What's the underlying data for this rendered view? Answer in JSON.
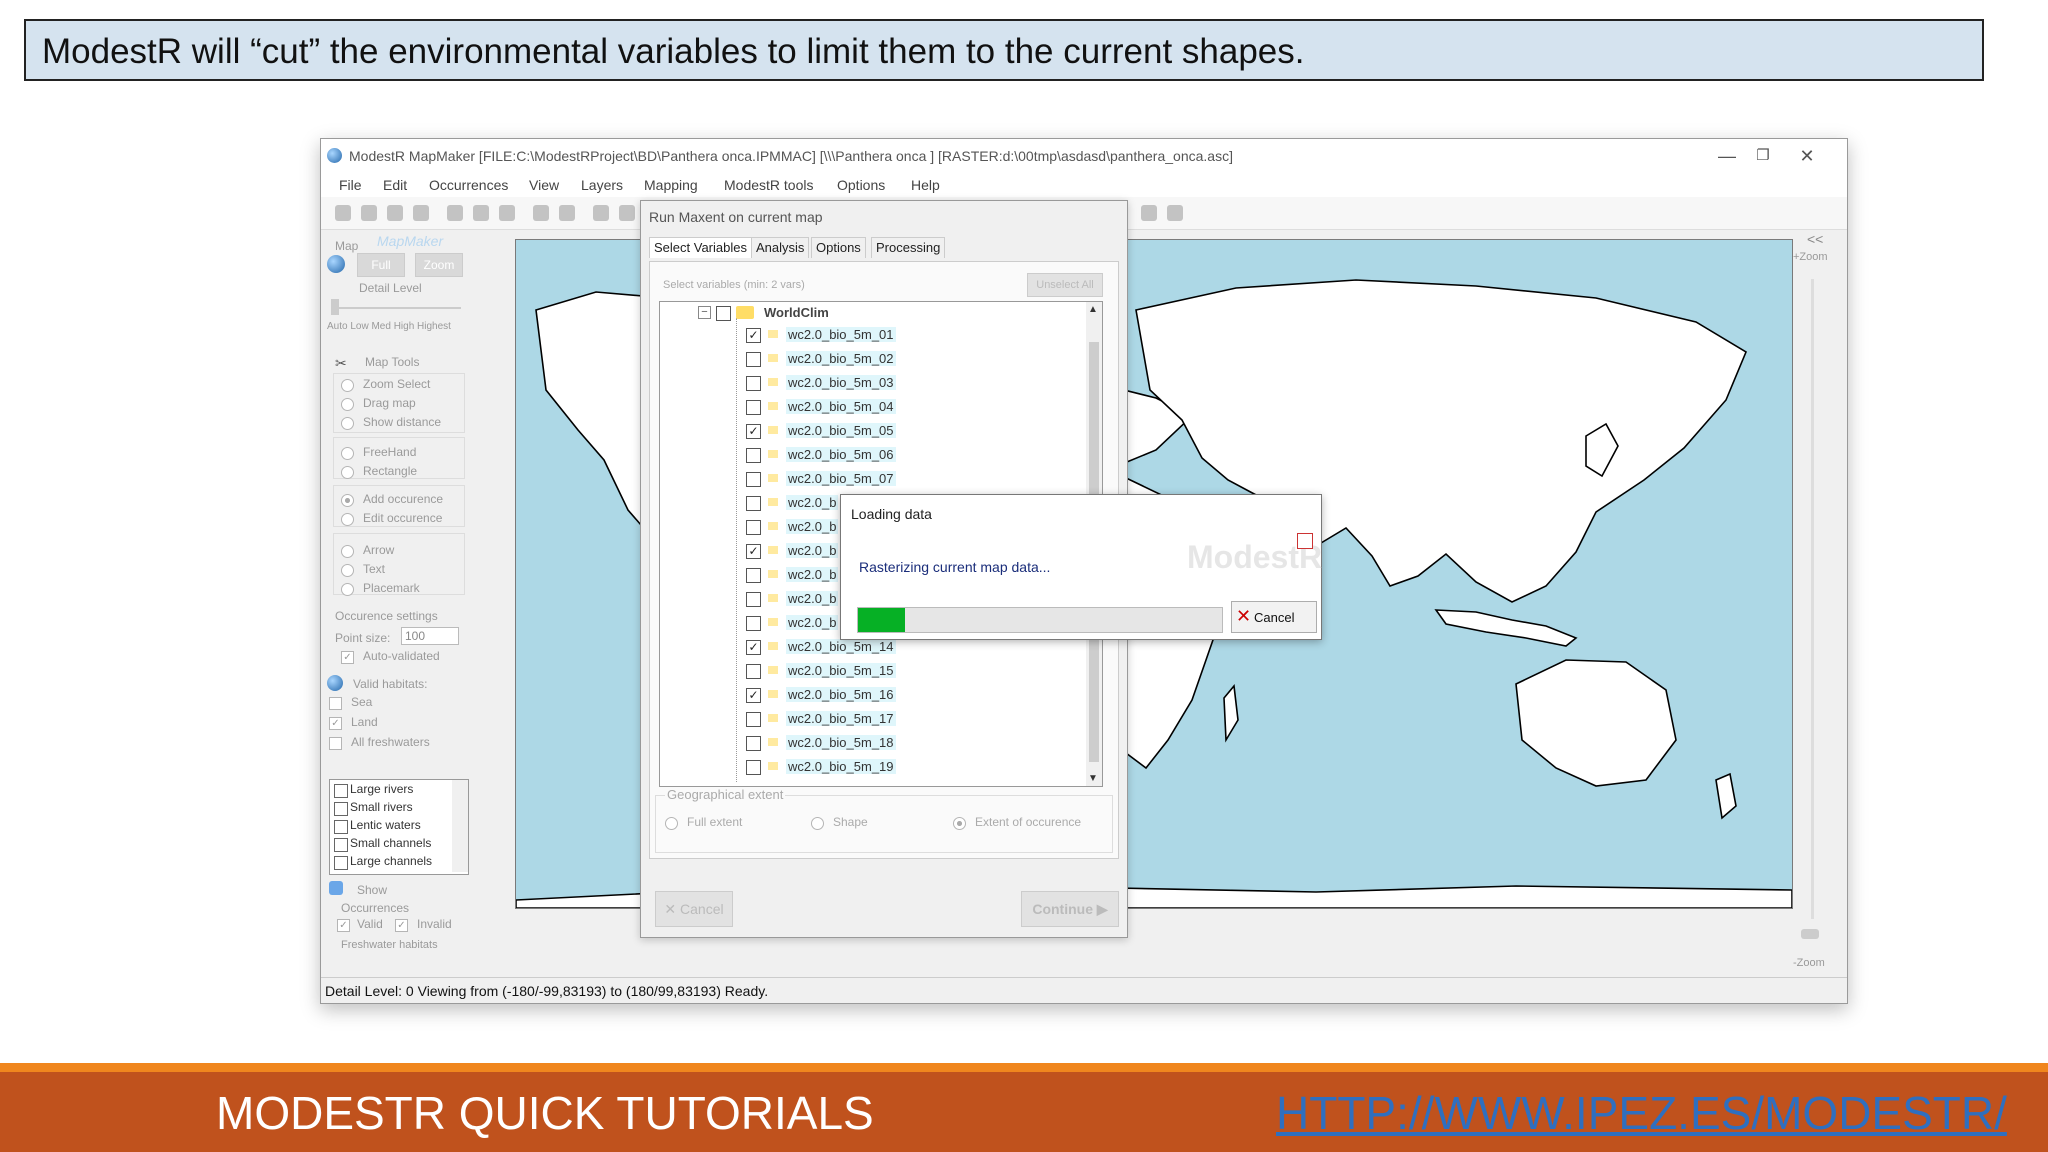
{
  "caption": "ModestR will “cut” the environmental variables to limit them to the current shapes.",
  "window": {
    "title": "ModestR MapMaker [FILE:C:\\ModestRProject\\BD\\Panthera onca.IPMMAC] [\\\\\\Panthera onca ] [RASTER:d:\\00tmp\\asdasd\\panthera_onca.asc]",
    "controls": {
      "minimize": "—",
      "restore": "❐",
      "close": "✕"
    },
    "menu": [
      "File",
      "Edit",
      "Occurrences",
      "View",
      "Layers",
      "Mapping",
      "ModestR tools",
      "Options",
      "Help"
    ]
  },
  "left_panel": {
    "map_label": "Map",
    "mapmaker_logo": "MapMaker",
    "full_btn": "Full",
    "zoom_btn": "Zoom",
    "detail_level": "Detail Level",
    "detail_scale": "Auto Low  Med  High  Highest",
    "map_tools": "Map Tools",
    "tools": [
      "Zoom Select",
      "Drag map",
      "Show distance",
      "FreeHand",
      "Rectangle",
      "Add occurence",
      "Edit occurence",
      "Arrow",
      "Text",
      "Placemark"
    ],
    "occ_settings": "Occurence settings",
    "point_size_label": "Point size:",
    "point_size": "100",
    "auto_validated": "Auto-validated",
    "valid_habitats": "Valid habitats:",
    "habitats": [
      "Sea",
      "Land",
      "All freshwaters"
    ],
    "freshwater_list": [
      "Large rivers",
      "Small rivers",
      "Lentic waters",
      "Small channels",
      "Large channels"
    ],
    "show": "Show",
    "occurrences": "Occurrences",
    "valid": "Valid",
    "invalid": "Invalid",
    "freshwater_habitats": "Freshwater habitats"
  },
  "zoom": {
    "plus": "+Zoom",
    "minus": "-Zoom",
    "collapse": "<<"
  },
  "status_bar": "Detail Level: 0   Viewing from (-180/-99,83193) to (180/99,83193)   Ready.",
  "maxent": {
    "title": "Run Maxent on current map",
    "tabs": [
      "Select Variables",
      "Analysis",
      "Options",
      "Processing"
    ],
    "select_hint": "Select variables (min: 2 vars)",
    "unselect_all": "Unselect All",
    "root": "WorldClim",
    "variables": [
      {
        "label": "wc2.0_bio_5m_01",
        "checked": true
      },
      {
        "label": "wc2.0_bio_5m_02",
        "checked": false
      },
      {
        "label": "wc2.0_bio_5m_03",
        "checked": false
      },
      {
        "label": "wc2.0_bio_5m_04",
        "checked": false
      },
      {
        "label": "wc2.0_bio_5m_05",
        "checked": true
      },
      {
        "label": "wc2.0_bio_5m_06",
        "checked": false
      },
      {
        "label": "wc2.0_bio_5m_07",
        "checked": false
      },
      {
        "label": "wc2.0_b",
        "checked": false
      },
      {
        "label": "wc2.0_b",
        "checked": false
      },
      {
        "label": "wc2.0_b",
        "checked": true
      },
      {
        "label": "wc2.0_b",
        "checked": false
      },
      {
        "label": "wc2.0_b",
        "checked": false
      },
      {
        "label": "wc2.0_b",
        "checked": false
      },
      {
        "label": "wc2.0_bio_5m_14",
        "checked": true
      },
      {
        "label": "wc2.0_bio_5m_15",
        "checked": false
      },
      {
        "label": "wc2.0_bio_5m_16",
        "checked": true
      },
      {
        "label": "wc2.0_bio_5m_17",
        "checked": false
      },
      {
        "label": "wc2.0_bio_5m_18",
        "checked": false
      },
      {
        "label": "wc2.0_bio_5m_19",
        "checked": false
      }
    ],
    "geo_extent": "Geographical extent",
    "extent_options": [
      "Full extent",
      "Shape",
      "Extent of occurence"
    ],
    "cancel": "Cancel",
    "continue": "Continue"
  },
  "loading": {
    "title": "Loading data",
    "message": "Rasterizing current map data...",
    "watermark": "ModestR",
    "progress": 0.13,
    "cancel": "Cancel"
  },
  "footer": {
    "left": "MODESTR QUICK TUTORIALS",
    "right": "HTTP://WWW.IPEZ.ES/MODESTR/"
  },
  "colors": {
    "ocean": "#add8e6",
    "land": "#ffffff",
    "progress": "#06b025",
    "footer": "#c0521d",
    "footer_accent": "#f0861e",
    "link": "#2f6fbf"
  }
}
